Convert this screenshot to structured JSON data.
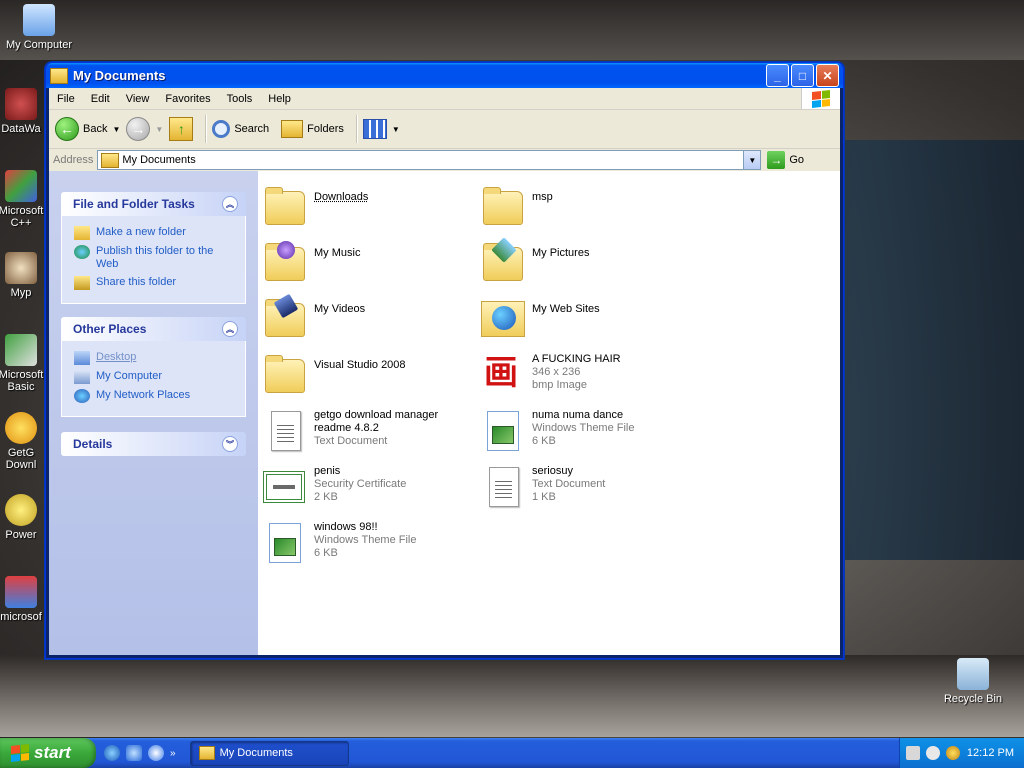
{
  "desktop": {
    "icons": [
      {
        "label": "My Computer"
      },
      {
        "label": "DataWa"
      },
      {
        "label": "Microsoft C++"
      },
      {
        "label": "Myp"
      },
      {
        "label": "Microsoft Basic"
      },
      {
        "label": "GetG Downl"
      },
      {
        "label": "Power"
      },
      {
        "label": "microsof"
      },
      {
        "label": "Recycle Bin"
      }
    ]
  },
  "window": {
    "title": "My Documents",
    "controls": {
      "minimize": "_",
      "maximize": "□",
      "close": "✕"
    }
  },
  "menu": [
    "File",
    "Edit",
    "View",
    "Favorites",
    "Tools",
    "Help"
  ],
  "toolbar": {
    "back": "Back",
    "search": "Search",
    "folders": "Folders"
  },
  "address": {
    "label": "Address",
    "value": "My Documents",
    "go": "Go"
  },
  "tasks": {
    "file_folder": {
      "title": "File and Folder Tasks",
      "items": [
        "Make a new folder",
        "Publish this folder to the Web",
        "Share this folder"
      ]
    },
    "other_places": {
      "title": "Other Places",
      "items": [
        "Desktop",
        "My Computer",
        "My Network Places"
      ]
    },
    "details": {
      "title": "Details"
    }
  },
  "files": [
    {
      "name": "Downloads",
      "type": "",
      "size": ""
    },
    {
      "name": "msp",
      "type": "",
      "size": ""
    },
    {
      "name": "My Music",
      "type": "",
      "size": ""
    },
    {
      "name": "My Pictures",
      "type": "",
      "size": ""
    },
    {
      "name": "My Videos",
      "type": "",
      "size": ""
    },
    {
      "name": "My Web Sites",
      "type": "",
      "size": ""
    },
    {
      "name": "Visual Studio 2008",
      "type": "",
      "size": ""
    },
    {
      "name": "A FUCKING HAIR",
      "type": "346 x 236",
      "size": "bmp Image"
    },
    {
      "name": "getgo download manager",
      "name2": "readme 4.8.2",
      "type": "Text Document",
      "size": ""
    },
    {
      "name": "numa numa dance",
      "type": "Windows Theme File",
      "size": "6 KB"
    },
    {
      "name": "penis",
      "type": "Security Certificate",
      "size": "2 KB"
    },
    {
      "name": "seriosuy",
      "type": "Text Document",
      "size": "1 KB"
    },
    {
      "name": "windows 98!!",
      "type": "Windows Theme File",
      "size": "6 KB"
    }
  ],
  "taskbar": {
    "start": "start",
    "task": "My Documents",
    "clock": "12:12 PM"
  }
}
